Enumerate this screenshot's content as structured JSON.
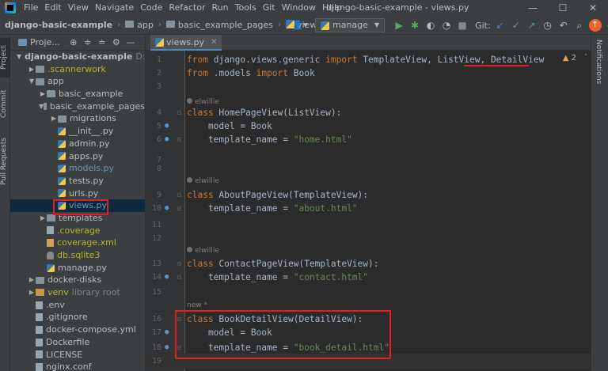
{
  "menubar": {
    "items": [
      "File",
      "Edit",
      "View",
      "Navigate",
      "Code",
      "Refactor",
      "Run",
      "Tools",
      "Git",
      "Window",
      "Help"
    ],
    "title": "django-basic-example - views.py",
    "minimize": "—",
    "maximize": "☐",
    "close": "✕"
  },
  "navbar": {
    "project": "django-basic-example",
    "crumbs": [
      "app",
      "basic_example_pages",
      "views.py"
    ],
    "run_config": "manage",
    "git_label": "Git:"
  },
  "left_strip": {
    "project_tab": "Project",
    "commit_tab": "Commit",
    "pull_requests_tab": "Pull Requests"
  },
  "right_strip": {
    "notifications_tab": "Notifications"
  },
  "project_panel": {
    "title": "Proje...",
    "tree": [
      {
        "label": "django-basic-example",
        "hint": "D:\\code\\",
        "indent": 0,
        "arrow": "down",
        "icon": "folder",
        "bold": true
      },
      {
        "label": ".scannerwork",
        "indent": 1,
        "arrow": "right",
        "icon": "folder",
        "color": "olive"
      },
      {
        "label": "app",
        "indent": 1,
        "arrow": "down",
        "icon": "folder"
      },
      {
        "label": "basic_example",
        "indent": 2,
        "arrow": "right",
        "icon": "folder"
      },
      {
        "label": "basic_example_pages",
        "indent": 2,
        "arrow": "down",
        "icon": "folder"
      },
      {
        "label": "migrations",
        "indent": 3,
        "arrow": "right",
        "icon": "folder"
      },
      {
        "label": "__init__.py",
        "indent": 3,
        "icon": "py"
      },
      {
        "label": "admin.py",
        "indent": 3,
        "icon": "py"
      },
      {
        "label": "apps.py",
        "indent": 3,
        "icon": "py"
      },
      {
        "label": "models.py",
        "indent": 3,
        "icon": "py",
        "color": "blue"
      },
      {
        "label": "tests.py",
        "indent": 3,
        "icon": "py"
      },
      {
        "label": "urls.py",
        "indent": 3,
        "icon": "py"
      },
      {
        "label": "views.py",
        "indent": 3,
        "icon": "py",
        "color": "blue",
        "selected": true
      },
      {
        "label": "templates",
        "indent": 2,
        "arrow": "right",
        "icon": "folder"
      },
      {
        "label": ".coverage",
        "indent": 2,
        "icon": "gen",
        "color": "olive"
      },
      {
        "label": "coverage.xml",
        "indent": 2,
        "icon": "xml",
        "color": "olive"
      },
      {
        "label": "db.sqlite3",
        "indent": 2,
        "icon": "db",
        "color": "olive"
      },
      {
        "label": "manage.py",
        "indent": 2,
        "icon": "py"
      },
      {
        "label": "docker-disks",
        "indent": 1,
        "arrow": "right",
        "icon": "folder"
      },
      {
        "label": "venv",
        "hint": "library root",
        "indent": 1,
        "arrow": "right",
        "icon": "folder-orange",
        "color": "olive"
      },
      {
        "label": ".env",
        "indent": 1,
        "icon": "gen"
      },
      {
        "label": ".gitignore",
        "indent": 1,
        "icon": "gen"
      },
      {
        "label": "docker-compose.yml",
        "indent": 1,
        "icon": "gen"
      },
      {
        "label": "Dockerfile",
        "indent": 1,
        "icon": "gen"
      },
      {
        "label": "LICENSE",
        "indent": 1,
        "icon": "gen"
      },
      {
        "label": "nginx.conf",
        "indent": 1,
        "icon": "gen"
      }
    ]
  },
  "editor": {
    "tab_label": "views.py",
    "warning_count": "2",
    "authors": {
      "home": "elwillie",
      "about": "elwillie",
      "contact": "elwillie",
      "new": "new *"
    },
    "lines": [
      {
        "n": "1",
        "parts": [
          [
            "kw",
            "from "
          ],
          [
            "t",
            "django.views.generic "
          ],
          [
            "kw",
            "import "
          ],
          [
            "t",
            "TemplateView, ListView, DetailView"
          ]
        ]
      },
      {
        "n": "2",
        "parts": [
          [
            "kw",
            "from "
          ],
          [
            "t",
            ".models "
          ],
          [
            "kw",
            "import "
          ],
          [
            "t",
            "Book"
          ]
        ]
      },
      {
        "n": "3",
        "parts": []
      },
      {
        "n": "4",
        "parts": [
          [
            "kw",
            "class "
          ],
          [
            "t",
            "HomePageView(ListView):"
          ]
        ]
      },
      {
        "n": "5",
        "parts": [
          [
            "t",
            "    model = Book"
          ]
        ]
      },
      {
        "n": "6",
        "parts": [
          [
            "t",
            "    template_name = "
          ],
          [
            "str",
            "\"home.html\""
          ]
        ]
      },
      {
        "n": "7",
        "parts": []
      },
      {
        "n": "8",
        "parts": []
      },
      {
        "n": "9",
        "parts": [
          [
            "kw",
            "class "
          ],
          [
            "t",
            "AboutPageView(TemplateView):"
          ]
        ]
      },
      {
        "n": "10",
        "parts": [
          [
            "t",
            "    template_name = "
          ],
          [
            "str",
            "\"about.html\""
          ]
        ]
      },
      {
        "n": "11",
        "parts": []
      },
      {
        "n": "12",
        "parts": []
      },
      {
        "n": "13",
        "parts": [
          [
            "kw",
            "class "
          ],
          [
            "t",
            "ContactPageView(TemplateView):"
          ]
        ]
      },
      {
        "n": "14",
        "parts": [
          [
            "t",
            "    template_name = "
          ],
          [
            "str",
            "\"contact.html\""
          ]
        ]
      },
      {
        "n": "15",
        "parts": []
      },
      {
        "n": "16",
        "parts": [
          [
            "kw",
            "class "
          ],
          [
            "t",
            "BookDetailView(DetailView):"
          ]
        ]
      },
      {
        "n": "17",
        "parts": [
          [
            "t",
            "    model = Book"
          ]
        ]
      },
      {
        "n": "18",
        "parts": [
          [
            "t",
            "    template_name = "
          ],
          [
            "str",
            "\"book_detail.html\""
          ]
        ]
      },
      {
        "n": "19",
        "parts": []
      }
    ]
  },
  "colors": {
    "keyword": "#cc7832",
    "string": "#6a8759",
    "annotation": "#e02020",
    "selection": "#0d293e"
  }
}
